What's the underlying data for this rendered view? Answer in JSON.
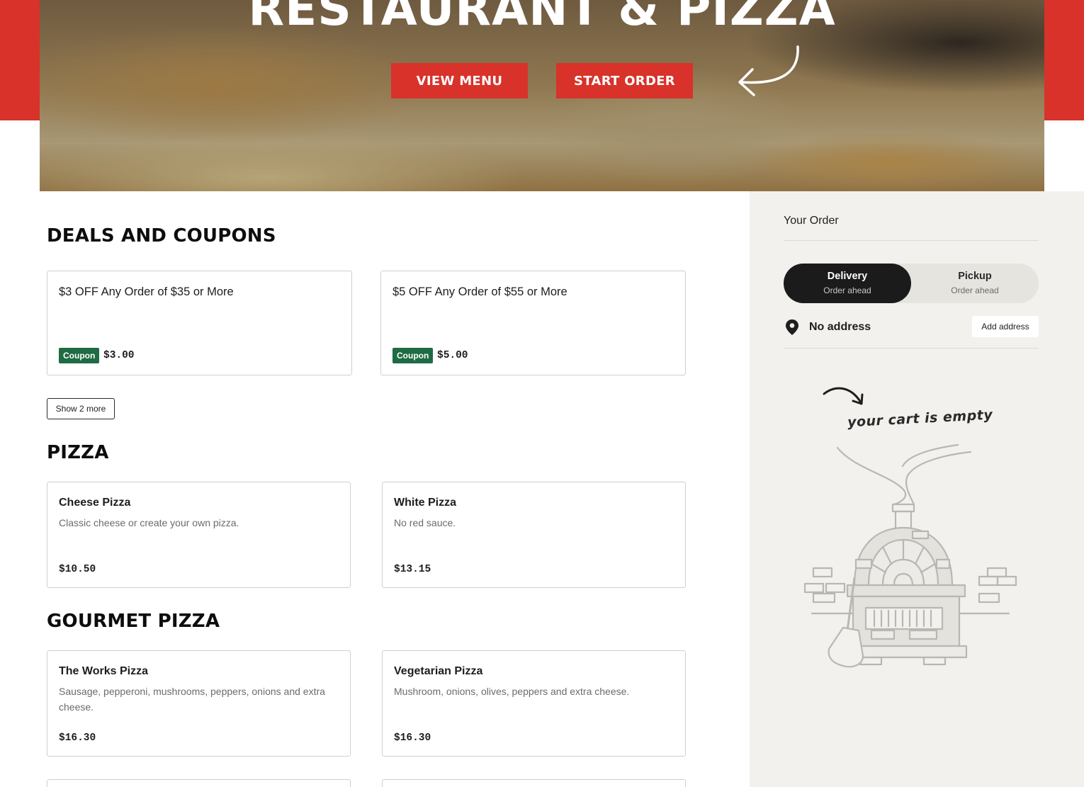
{
  "hero": {
    "title": "RESTAURANT & PIZZA",
    "view_menu": "VIEW MENU",
    "start_order": "START ORDER"
  },
  "deals": {
    "title": "DEALS AND COUPONS",
    "items": [
      {
        "title": "$3 OFF Any Order of $35 or More",
        "badge": "Coupon",
        "price": "$3.00"
      },
      {
        "title": "$5 OFF Any Order of $55 or More",
        "badge": "Coupon",
        "price": "$5.00"
      }
    ],
    "show_more": "Show 2 more"
  },
  "pizza": {
    "title": "PIZZA",
    "items": [
      {
        "title": "Cheese Pizza",
        "desc": "Classic cheese or create your own pizza.",
        "price": "$10.50"
      },
      {
        "title": "White Pizza",
        "desc": "No red sauce.",
        "price": "$13.15"
      }
    ]
  },
  "gourmet": {
    "title": "GOURMET PIZZA",
    "items": [
      {
        "title": "The Works Pizza",
        "desc": "Sausage, pepperoni, mushrooms, peppers, onions and extra cheese.",
        "price": "$16.30"
      },
      {
        "title": "Vegetarian Pizza",
        "desc": "Mushroom, onions, olives, peppers and extra cheese.",
        "price": "$16.30"
      }
    ]
  },
  "order": {
    "title": "Your Order",
    "delivery": {
      "label": "Delivery",
      "sub": "Order ahead"
    },
    "pickup": {
      "label": "Pickup",
      "sub": "Order ahead"
    },
    "no_address": "No address",
    "add_address": "Add address",
    "cart_empty": "your cart is empty"
  },
  "colors": {
    "brand_red": "#d8322a",
    "coupon_green": "#1f6b43",
    "sidebar_bg": "#f2f1ee",
    "toggle_active": "#1b1b1b"
  },
  "icons": [
    "curved-arrow-icon",
    "map-pin-icon",
    "doodle-arrow-icon",
    "pizza-oven-illustration"
  ]
}
